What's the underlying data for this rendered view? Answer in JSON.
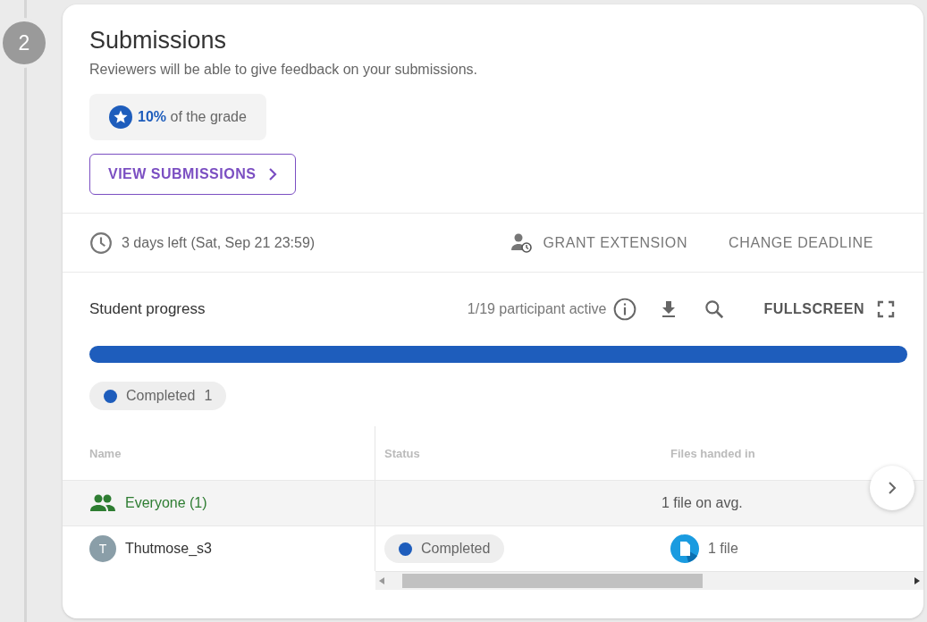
{
  "step": {
    "number": "2"
  },
  "header": {
    "title": "Submissions",
    "subtitle": "Reviewers will be able to give feedback on your submissions."
  },
  "grade": {
    "text": "**10%** of the grade"
  },
  "view_button": {
    "label": "VIEW SUBMISSIONS"
  },
  "deadline": {
    "text": "3 days left (Sat, Sep 21 23:59)",
    "actions": [
      {
        "label": "GRANT EXTENSION",
        "kind": "icon"
      },
      {
        "label": "CHANGE DEADLINE",
        "kind": "plain"
      }
    ]
  },
  "progress": {
    "title": "Student progress",
    "active": "1/19 participant active",
    "fullscreen": "FULLSCREEN",
    "level": 1,
    "color": "#1e5dbc",
    "legend": [
      {
        "label": "Completed",
        "count": "1",
        "color": "#1e5dbc"
      }
    ]
  },
  "table": {
    "columns": [
      "Name",
      "Status",
      "Files handed in"
    ],
    "rows": [
      {
        "kind": "group",
        "name": "Everyone (1)",
        "files": "1 file on avg."
      },
      {
        "kind": "student",
        "initial": "T",
        "name": "Thutmose_s3",
        "status": "Completed",
        "color": "#1e5dbc",
        "files": "1 file"
      }
    ]
  }
}
